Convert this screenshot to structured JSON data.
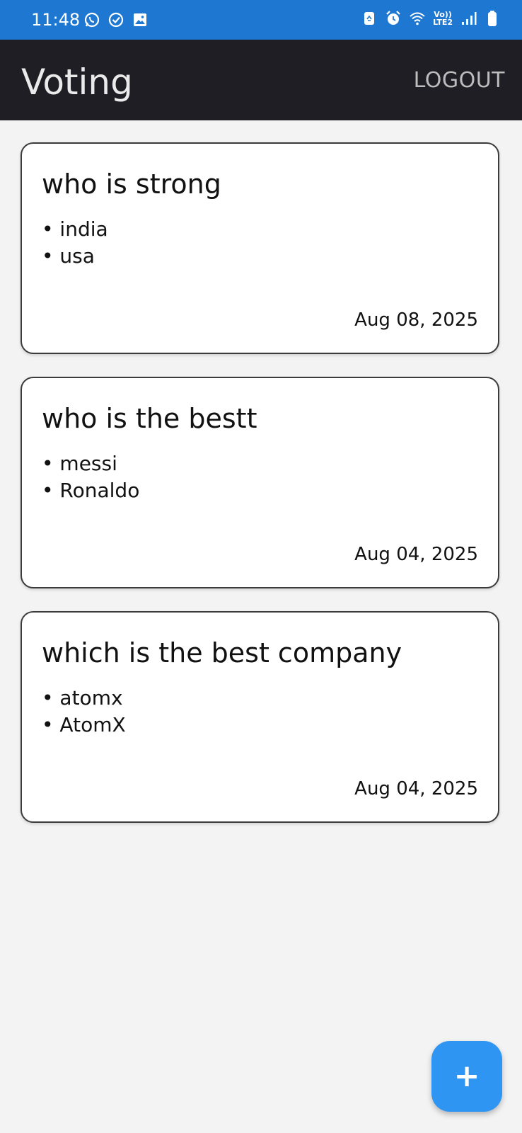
{
  "status_bar": {
    "time": "11:48",
    "left_icons": [
      "whatsapp-icon",
      "check-circle-icon",
      "image-icon"
    ],
    "right_icons": [
      "recycle-icon",
      "alarm-icon",
      "wifi-icon",
      "lte-icon",
      "signal-icon",
      "battery-icon"
    ],
    "network_label_top": "Vo))",
    "network_label_bottom": "LTE2"
  },
  "app_bar": {
    "title": "Voting",
    "logout_label": "LOGOUT"
  },
  "polls": [
    {
      "title": "who is strong",
      "options": [
        "india",
        "usa"
      ],
      "date": "Aug 08, 2025"
    },
    {
      "title": "who is the bestt",
      "options": [
        "messi",
        "Ronaldo"
      ],
      "date": "Aug 04, 2025"
    },
    {
      "title": "which is the best company",
      "options": [
        "atomx",
        "AtomX"
      ],
      "date": "Aug 04, 2025"
    }
  ],
  "fab": {
    "icon": "plus-icon",
    "label": "+"
  },
  "colors": {
    "status_bar": "#1e78d2",
    "app_bar": "#1e1e24",
    "background": "#f3f3f3",
    "fab": "#2e96f2"
  }
}
